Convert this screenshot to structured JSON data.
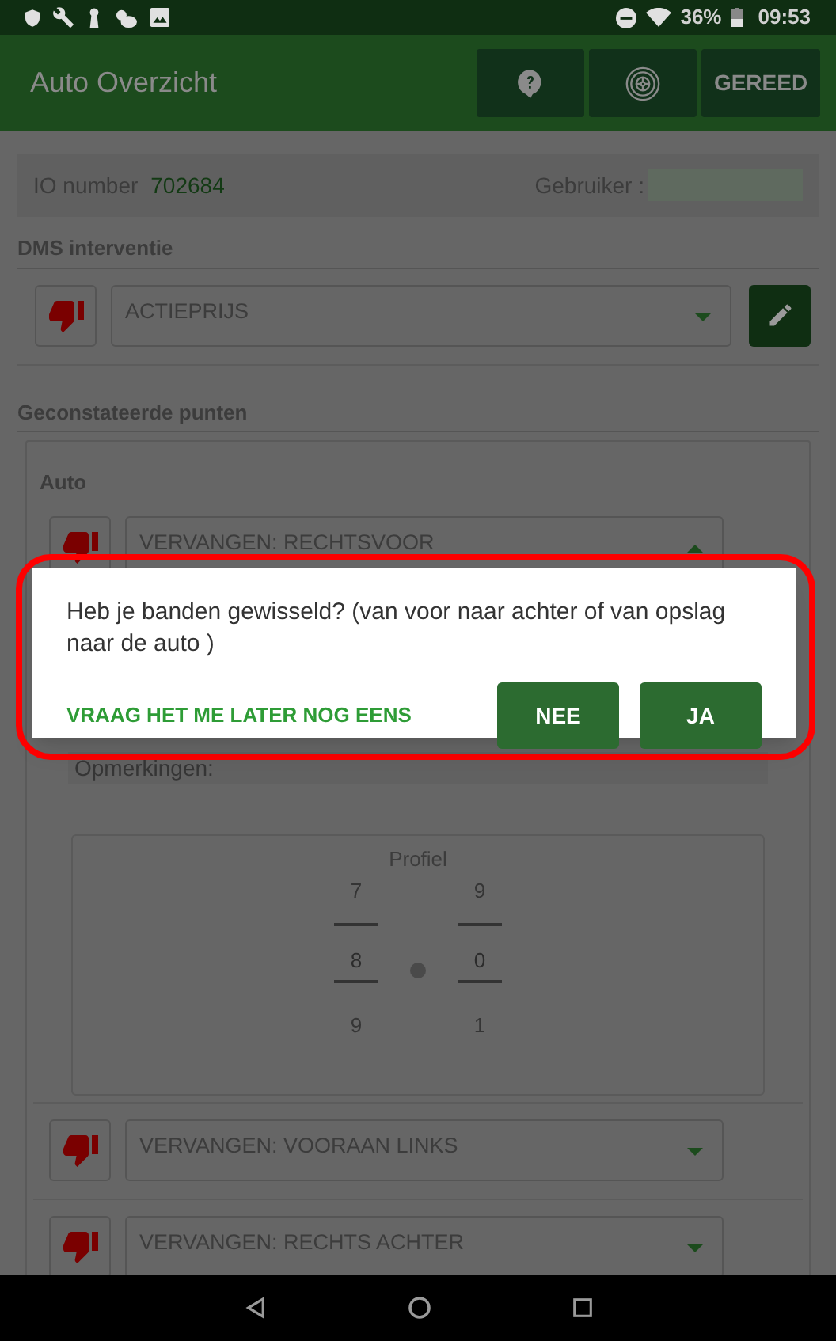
{
  "status_bar": {
    "battery": "36%",
    "time": "09:53"
  },
  "app_bar": {
    "title": "Auto Overzicht",
    "buttons": [
      {
        "kind": "help"
      },
      {
        "kind": "tire"
      },
      {
        "kind": "text",
        "label": "GEREED"
      }
    ]
  },
  "info": {
    "io_label": "IO number",
    "io_value": "702684",
    "user_label": "Gebruiker :"
  },
  "dms": {
    "title": "DMS interventie",
    "value": "ACTIEPRIJS",
    "expanded": false
  },
  "findings": {
    "title": "Geconstateerde punten",
    "group": "Auto",
    "items": [
      {
        "value": "VERVANGEN: RECHTSVOOR",
        "expanded": true,
        "remarks_label": "Opmerkingen:",
        "profile": {
          "title": "Profiel",
          "columns": [
            {
              "above": "7",
              "value": "8",
              "below": "9"
            },
            {
              "above": "9",
              "value": "0",
              "below": "1"
            }
          ]
        }
      },
      {
        "value": "VERVANGEN: VOORAAN LINKS",
        "expanded": false
      },
      {
        "value": "VERVANGEN: RECHTS ACHTER",
        "expanded": false
      }
    ]
  },
  "dialog": {
    "message": "Heb je banden gewisseld? (van voor naar achter of van opslag naar de auto )",
    "later_label": "VRAAG HET ME LATER NOG EENS",
    "buttons": [
      "NEE",
      "JA"
    ]
  }
}
